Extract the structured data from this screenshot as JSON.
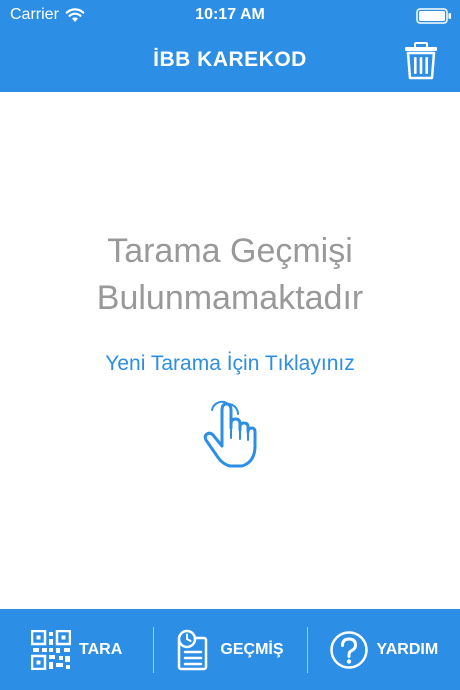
{
  "status_bar": {
    "carrier": "Carrier",
    "time": "10:17 AM"
  },
  "nav": {
    "title": "İBB KAREKOD",
    "trash_icon": "trash-icon"
  },
  "empty_state": {
    "title_line1": "Tarama Geçmişi",
    "title_line2": "Bulunmamaktadır",
    "link_label": "Yeni Tarama İçin Tıklayınız",
    "icon": "hand-tap-icon"
  },
  "tabs": [
    {
      "label": "TARA",
      "icon": "qr-code-icon"
    },
    {
      "label": "GEÇMİŞ",
      "icon": "history-icon"
    },
    {
      "label": "YARDIM",
      "icon": "help-icon"
    }
  ],
  "colors": {
    "accent": "#2d8ee6",
    "muted_text": "#999999",
    "background": "#ffffff"
  }
}
